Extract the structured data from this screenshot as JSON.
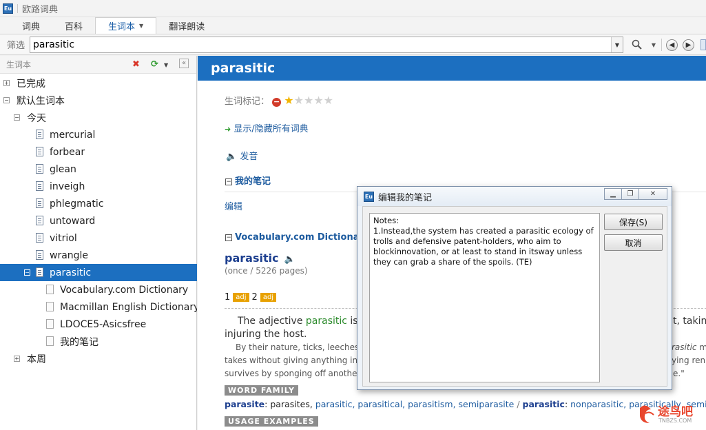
{
  "app": {
    "title": "欧路词典",
    "icon_text": "Eu"
  },
  "tabs": [
    {
      "label": "词典"
    },
    {
      "label": "百科"
    },
    {
      "label": "生词本",
      "active": true
    },
    {
      "label": "翻译朗读"
    }
  ],
  "filter": {
    "label": "筛选",
    "value": "parasitic"
  },
  "sidebar": {
    "title": "生词本",
    "tree": {
      "completed": "已完成",
      "default_book": "默认生词本",
      "today": "今天",
      "words": [
        "mercurial",
        "forbear",
        "glean",
        "inveigh",
        "phlegmatic",
        "untoward",
        "vitriol",
        "wrangle"
      ],
      "selected_word": "parasitic",
      "children": [
        "Vocabulary.com Dictionary",
        "Macmillan English Dictionary for",
        "LDOCE5-Asicsfree",
        "我的笔记"
      ],
      "this_week": "本周"
    }
  },
  "main": {
    "word": "parasitic",
    "rating_label": "生词标记：",
    "rating": 1,
    "rating_max": 5,
    "toggle_dicts": "显示/隐藏所有词典",
    "pronounce": "发音",
    "my_notes_heading": "我的笔记",
    "edit_link": "编辑",
    "vocab_heading": "Vocabulary.com Dictionary",
    "entry_word": "parasitic",
    "pages": "(once / 5226 pages)",
    "sense1_num": "1",
    "sense1_pos": "adj",
    "sense2_num": "2",
    "sense2_pos": "adj",
    "para1_a": "The adjective",
    "para1_word": "parasitic",
    "para1_b": "is m",
    "para1_right": "t, taking",
    "para1_line2": "injuring the host.",
    "para2_line1": "By their nature, ticks, leeches,",
    "para2_right1_italic": "rasitic",
    "para2_right1": " m",
    "para2_line2": "takes without giving anything in re",
    "para2_right2": "ying ren",
    "para2_line3": "survives by sponging off another p",
    "para2_right3": "e.\"",
    "word_family_tag": "WORD FAMILY",
    "word_family": {
      "head1": "parasite",
      "items1": "parasites,",
      "links1": [
        "parasitic,",
        "parasitical,",
        "parasitism,",
        "semiparasite"
      ],
      "slash": "/",
      "head2": "parasitic",
      "links2": [
        "nonparasitic,",
        "parasitically,",
        "semiparasitic"
      ]
    },
    "usage_tag": "USAGE EXAMPLES"
  },
  "dialog": {
    "title": "编辑我的笔记",
    "notes": "Notes:\n1.Instead,the system has created a parasitic ecology of trolls and defensive patent-holders, who aim to blockinnovation, or at least to stand in itsway unless they can grab a share of the spoils. (TE)",
    "save_label": "保存(S)",
    "cancel_label": "取消"
  },
  "watermark": {
    "text": "途鸟吧",
    "subtext": "TNBZS.COM"
  },
  "colors": {
    "accent": "#1c6fc0",
    "link": "#1d5b9f",
    "badge": "#e8a100",
    "star": "#f2b400"
  }
}
